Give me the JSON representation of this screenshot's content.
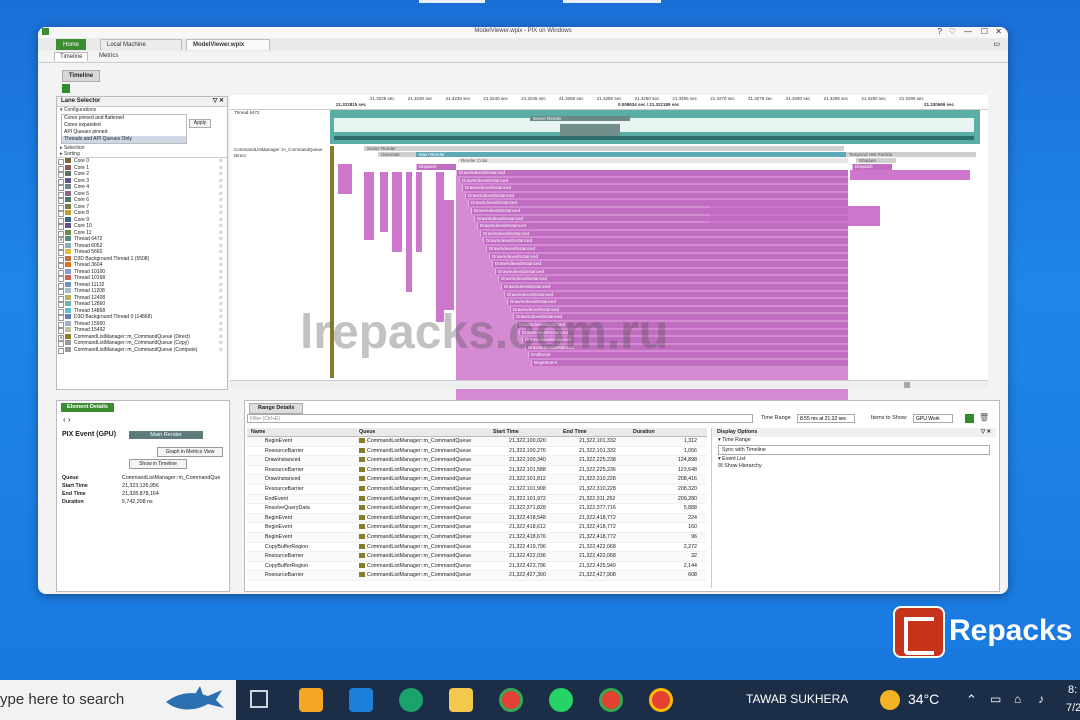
{
  "window": {
    "title": "ModelViewer.wpix - PIX on Windows",
    "controls": [
      "?",
      "♡",
      "—",
      "☐",
      "✕"
    ]
  },
  "tabs": [
    {
      "label": "Home"
    },
    {
      "label": "Local Machine"
    },
    {
      "label": "ModelViewer.wpix"
    }
  ],
  "subtabs": [
    {
      "label": "Timeline"
    },
    {
      "label": "Metrics"
    }
  ],
  "timeline_header": "Timeline",
  "lane_selector": {
    "title": "Lane Selector",
    "configurations_label": "Configurations",
    "apply_label": "Apply",
    "configs": [
      "Cores pinned and flattened",
      "Cores expanded",
      "API Queues pinned",
      "Threads and API Queues Only"
    ],
    "selection_label": "Selection",
    "sorting_label": "Sorting",
    "lanes": [
      {
        "name": "Core 0",
        "color": "#7a6a3a",
        "checked": false
      },
      {
        "name": "Core 1",
        "color": "#8a5a5a",
        "checked": false
      },
      {
        "name": "Core 2",
        "color": "#5a7a5a",
        "checked": false
      },
      {
        "name": "Core 3",
        "color": "#5a5a8a",
        "checked": false
      },
      {
        "name": "Core 4",
        "color": "#6a8a8a",
        "checked": false
      },
      {
        "name": "Core 5",
        "color": "#8a6a8a",
        "checked": false
      },
      {
        "name": "Core 6",
        "color": "#4a7a6a",
        "checked": false
      },
      {
        "name": "Core 7",
        "color": "#7a7a4a",
        "checked": false
      },
      {
        "name": "Core 8",
        "color": "#c0a030",
        "checked": false
      },
      {
        "name": "Core 9",
        "color": "#3a6a8a",
        "checked": false
      },
      {
        "name": "Core 10",
        "color": "#6a4a8a",
        "checked": false
      },
      {
        "name": "Core 11",
        "color": "#6a8a4a",
        "checked": false
      },
      {
        "name": "Thread 6472",
        "color": "#5a8a7a",
        "checked": true
      },
      {
        "name": "Thread 6052",
        "color": "#8ab0c0",
        "checked": false
      },
      {
        "name": "Thread 5660",
        "color": "#e0c040",
        "checked": false
      },
      {
        "name": "D3D Background Thread 1 (5508)",
        "color": "#c07040",
        "checked": false
      },
      {
        "name": "Thread 3604",
        "color": "#e07020",
        "checked": false
      },
      {
        "name": "Thread 10100",
        "color": "#80a0d0",
        "checked": false
      },
      {
        "name": "Thread 10168",
        "color": "#d06060",
        "checked": false
      },
      {
        "name": "Thread 11132",
        "color": "#7090c0",
        "checked": false
      },
      {
        "name": "Thread 11208",
        "color": "#a0c0d0",
        "checked": false
      },
      {
        "name": "Thread 12408",
        "color": "#b0b060",
        "checked": false
      },
      {
        "name": "Thread 12860",
        "color": "#70b0b0",
        "checked": false
      },
      {
        "name": "Thread 14868",
        "color": "#60c0d0",
        "checked": false
      },
      {
        "name": "D3D Background Thread 0 (14868)",
        "color": "#6080c0",
        "checked": false
      },
      {
        "name": "Thread 15900",
        "color": "#a0b0c0",
        "checked": false
      },
      {
        "name": "Thread 15492",
        "color": "#c0c0a0",
        "checked": false
      },
      {
        "name": "CommandListManager::m_CommandQueue (Direct)",
        "color": "#8b7a2a",
        "checked": true
      },
      {
        "name": "CommandListManager::m_CommandQueue (Copy)",
        "color": "#9a9a9a",
        "checked": false
      },
      {
        "name": "CommandListManager::m_CommandQueue (Compute)",
        "color": "#9a9a9a",
        "checked": false
      }
    ]
  },
  "ruler": {
    "ticks": [
      "21.3225 sec",
      "21.3230 sec",
      "21.3235 sec",
      "21.3240 sec",
      "21.3245 sec",
      "21.3250 sec",
      "21.3255 sec",
      "21.3260 sec",
      "21.3265 sec",
      "21.3270 sec",
      "21.3275 sec",
      "21.3280 sec",
      "21.3285 sec",
      "21.3290 sec",
      "21.3295 sec"
    ],
    "start": "21.322815 sec",
    "center": "0.008634 sec / 21.322189 sec",
    "end": "21.330669 sec"
  },
  "tracks": {
    "thread_label": "Thread 6472",
    "queue_label": "CommandListManager::m_CommandQueue",
    "queue_sub": "Direct",
    "scene_render": "Scene Render",
    "generate": "Generate",
    "main_render": "Main Render",
    "render_color": "Render Color",
    "temporal": "Temporal HW Particle",
    "dispatch": "Dispatch",
    "sharpen": "Sharpen",
    "draw_label": "DrawIndexedInstanced",
    "end_event": "EndEvent",
    "begin_event": "BeginEvent"
  },
  "element_details": {
    "tab": "Element Details",
    "event_type": "PIX Event (GPU)",
    "event_name": "Main Render",
    "graph_button": "Graph in Metrics View",
    "timeline_button": "Show in Timeline",
    "props": [
      {
        "k": "Queue",
        "v": "CommandListManager::m_CommandQue"
      },
      {
        "k": "Start Time",
        "v": "21,323,135,956"
      },
      {
        "k": "End Time",
        "v": "21,328,878,164"
      },
      {
        "k": "Duration",
        "v": "5,742,208 ns"
      }
    ]
  },
  "range_details": {
    "tab": "Range Details",
    "filter_placeholder": "Filter (Ctrl+E)",
    "time_range_label": "Time Range",
    "time_range_value": "8.55 ms at 21.32 sec",
    "items_label": "Items to Show:",
    "items_value": "GPU Work",
    "columns": [
      "Name",
      "Queue",
      "Start Time",
      "End Time",
      "Duration"
    ],
    "rows": [
      {
        "name": "BeginEvent",
        "queue": "CommandListManager::m_CommandQueue",
        "start": "21,322,100,020",
        "end": "21,322,101,332",
        "dur": "1,312"
      },
      {
        "name": "ResourceBarrier",
        "queue": "CommandListManager::m_CommandQueue",
        "start": "21,322,100,276",
        "end": "21,322,101,332",
        "dur": "1,056"
      },
      {
        "name": "DrawInstanced",
        "queue": "CommandListManager::m_CommandQueue",
        "start": "21,322,100,340",
        "end": "21,322,225,238",
        "dur": "124,898"
      },
      {
        "name": "ResourceBarrier",
        "queue": "CommandListManager::m_CommandQueue",
        "start": "21,322,101,588",
        "end": "21,322,225,236",
        "dur": "123,648"
      },
      {
        "name": "DrawInstanced",
        "queue": "CommandListManager::m_CommandQueue",
        "start": "21,322,101,812",
        "end": "21,322,310,228",
        "dur": "208,416"
      },
      {
        "name": "ResourceBarrier",
        "queue": "CommandListManager::m_CommandQueue",
        "start": "21,322,101,908",
        "end": "21,322,310,228",
        "dur": "208,320"
      },
      {
        "name": "EndEvent",
        "queue": "CommandListManager::m_CommandQueue",
        "start": "21,322,101,972",
        "end": "21,322,311,252",
        "dur": "209,280"
      },
      {
        "name": "ResolveQueryData",
        "queue": "CommandListManager::m_CommandQueue",
        "start": "21,322,371,828",
        "end": "21,322,377,716",
        "dur": "5,888"
      },
      {
        "name": "BeginEvent",
        "queue": "CommandListManager::m_CommandQueue",
        "start": "21,322,418,548",
        "end": "21,322,418,772",
        "dur": "224"
      },
      {
        "name": "BeginEvent",
        "queue": "CommandListManager::m_CommandQueue",
        "start": "21,322,418,612",
        "end": "21,322,418,772",
        "dur": "160"
      },
      {
        "name": "BeginEvent",
        "queue": "CommandListManager::m_CommandQueue",
        "start": "21,322,418,676",
        "end": "21,322,418,772",
        "dur": "96"
      },
      {
        "name": "CopyBufferRegion",
        "queue": "CommandListManager::m_CommandQueue",
        "start": "21,322,419,796",
        "end": "21,322,422,068",
        "dur": "2,272"
      },
      {
        "name": "ResourceBarrier",
        "queue": "CommandListManager::m_CommandQueue",
        "start": "21,322,422,036",
        "end": "21,322,422,068",
        "dur": "32"
      },
      {
        "name": "CopyBufferRegion",
        "queue": "CommandListManager::m_CommandQueue",
        "start": "21,322,423,796",
        "end": "21,322,425,940",
        "dur": "2,144"
      },
      {
        "name": "ResourceBarrier",
        "queue": "CommandListManager::m_CommandQueue",
        "start": "21,322,427,300",
        "end": "21,322,427,908",
        "dur": "608"
      }
    ],
    "display_options": {
      "title": "Display Options",
      "time_range": "Time Range",
      "sync": "Sync with Timeline",
      "event_list": "Event List",
      "hierarchy": "Show Hierarchy"
    }
  },
  "watermark": "lrepacks.com.ru",
  "logo_text": "Repacks",
  "taskbar": {
    "search_text": "ype here to search",
    "user": "TAWAB SUKHERA",
    "temp": "34°C",
    "clock_a": "8:",
    "clock_b": "7/2"
  }
}
